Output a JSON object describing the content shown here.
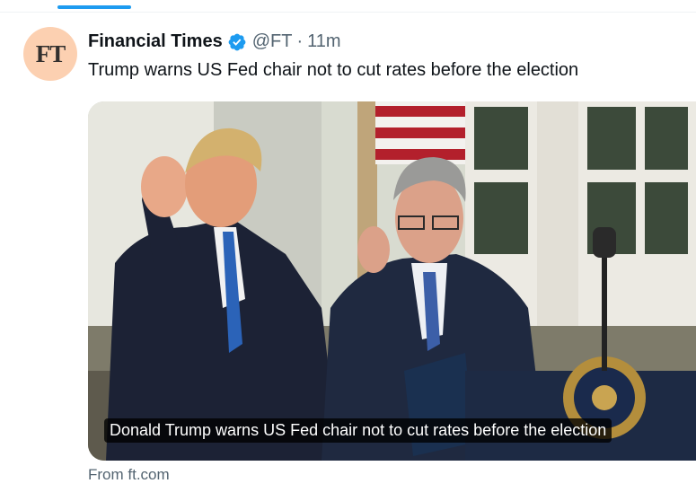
{
  "tweet": {
    "author": {
      "avatar_text": "FT",
      "display_name": "Financial Times",
      "handle": "@FT",
      "time_separator": "·",
      "timestamp": "11m",
      "verified_icon": "verified-badge-icon"
    },
    "text": "Trump warns US Fed chair not to cut rates before the election",
    "media": {
      "caption": "Donald Trump warns US Fed chair not to cut rates before the election"
    },
    "link_source": "From ft.com"
  },
  "colors": {
    "accent": "#1d9bf0",
    "avatar_bg": "#fcd0b1",
    "secondary_text": "#536471",
    "primary_text": "#0f1419"
  }
}
